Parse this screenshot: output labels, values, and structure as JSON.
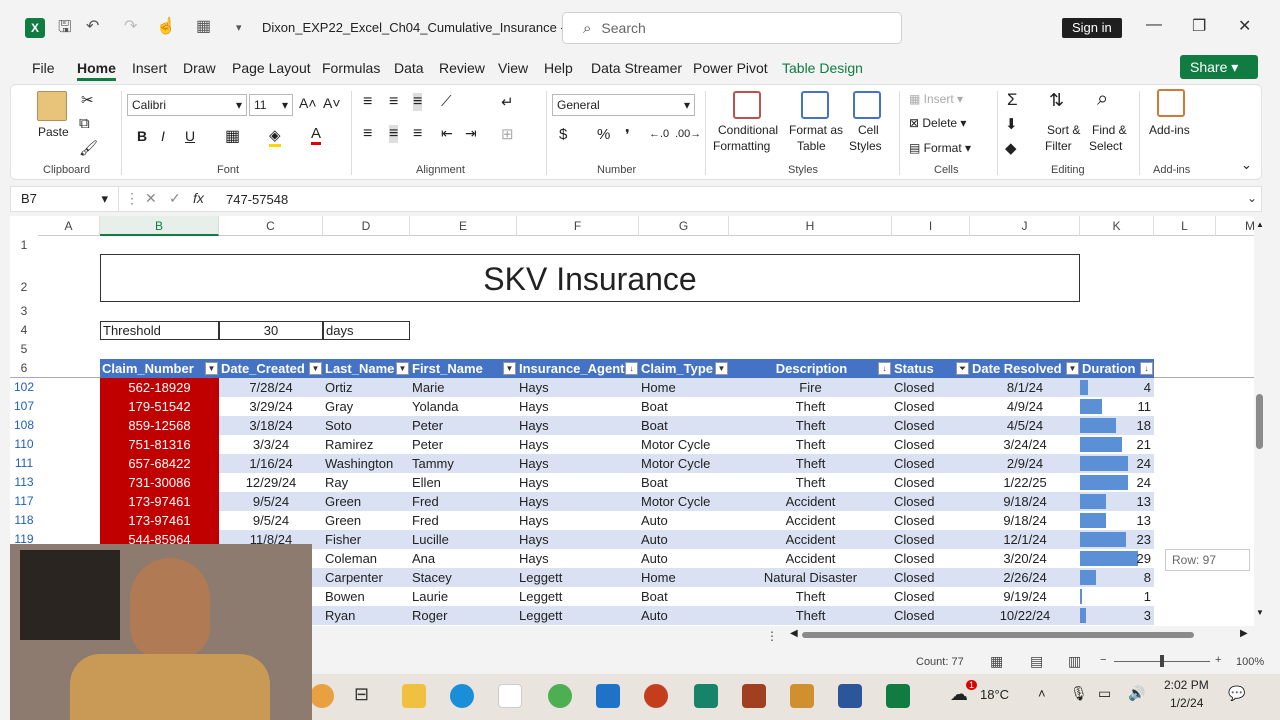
{
  "title_bar": {
    "doc_title": "Dixon_EXP22_Excel_Ch04_Cumulative_Insurance  -...",
    "search_placeholder": "Search",
    "sign_in": "Sign in",
    "app_letter": "X"
  },
  "menu": [
    "File",
    "Home",
    "Insert",
    "Draw",
    "Page Layout",
    "Formulas",
    "Data",
    "Review",
    "View",
    "Help",
    "Data Streamer",
    "Power Pivot",
    "Table Design"
  ],
  "share_label": "Share",
  "ribbon": {
    "clipboard": {
      "paste": "Paste",
      "label": "Clipboard"
    },
    "font": {
      "name": "Calibri",
      "size": "11",
      "label": "Font"
    },
    "alignment": {
      "label": "Alignment"
    },
    "number": {
      "format": "General",
      "label": "Number"
    },
    "styles": {
      "conditional": "Conditional",
      "formatting": "Formatting",
      "format_as": "Format as",
      "table": "Table",
      "cell": "Cell",
      "cell_styles": "Styles",
      "label": "Styles"
    },
    "cells": {
      "insert": "Insert",
      "delete": "Delete",
      "format": "Format",
      "label": "Cells"
    },
    "editing": {
      "sort": "Sort &",
      "filter": "Filter",
      "find": "Find &",
      "select": "Select",
      "label": "Editing"
    },
    "addins": {
      "addins": "Add-ins",
      "label": "Add-ins"
    }
  },
  "formula_bar": {
    "name_box": "B7",
    "fx": "fx",
    "value": "747-57548"
  },
  "columns": [
    "A",
    "B",
    "C",
    "D",
    "E",
    "F",
    "G",
    "H",
    "I",
    "J",
    "K",
    "L",
    "M"
  ],
  "sheet_title": "SKV Insurance",
  "threshold": {
    "label": "Threshold",
    "value": "30",
    "unit": "days"
  },
  "headers": [
    "Claim_Number",
    "Date_Created",
    "Last_Name",
    "First_Name",
    "Insurance_Agent",
    "Claim_Type",
    "Description",
    "Status",
    "Date Resolved",
    "Duration"
  ],
  "rows": [
    {
      "row": "102",
      "claim": "562-18929",
      "date": "7/28/24",
      "last": "Ortiz",
      "first": "Marie",
      "agent": "Hays",
      "type": "Home",
      "desc": "Fire",
      "status": "Closed",
      "resolved": "8/1/24",
      "duration": "4",
      "dur_value": 4
    },
    {
      "row": "107",
      "claim": "179-51542",
      "date": "3/29/24",
      "last": "Gray",
      "first": "Yolanda",
      "agent": "Hays",
      "type": "Boat",
      "desc": "Theft",
      "status": "Closed",
      "resolved": "4/9/24",
      "duration": "11",
      "dur_value": 11
    },
    {
      "row": "108",
      "claim": "859-12568",
      "date": "3/18/24",
      "last": "Soto",
      "first": "Peter",
      "agent": "Hays",
      "type": "Boat",
      "desc": "Theft",
      "status": "Closed",
      "resolved": "4/5/24",
      "duration": "18",
      "dur_value": 18
    },
    {
      "row": "110",
      "claim": "751-81316",
      "date": "3/3/24",
      "last": "Ramirez",
      "first": "Peter",
      "agent": "Hays",
      "type": "Motor Cycle",
      "desc": "Theft",
      "status": "Closed",
      "resolved": "3/24/24",
      "duration": "21",
      "dur_value": 21
    },
    {
      "row": "111",
      "claim": "657-68422",
      "date": "1/16/24",
      "last": "Washington",
      "first": "Tammy",
      "agent": "Hays",
      "type": "Motor Cycle",
      "desc": "Theft",
      "status": "Closed",
      "resolved": "2/9/24",
      "duration": "24",
      "dur_value": 24
    },
    {
      "row": "113",
      "claim": "731-30086",
      "date": "12/29/24",
      "last": "Ray",
      "first": "Ellen",
      "agent": "Hays",
      "type": "Boat",
      "desc": "Theft",
      "status": "Closed",
      "resolved": "1/22/25",
      "duration": "24",
      "dur_value": 24
    },
    {
      "row": "117",
      "claim": "173-97461",
      "date": "9/5/24",
      "last": "Green",
      "first": "Fred",
      "agent": "Hays",
      "type": "Motor Cycle",
      "desc": "Accident",
      "status": "Closed",
      "resolved": "9/18/24",
      "duration": "13",
      "dur_value": 13
    },
    {
      "row": "118",
      "claim": "173-97461",
      "date": "9/5/24",
      "last": "Green",
      "first": "Fred",
      "agent": "Hays",
      "type": "Auto",
      "desc": "Accident",
      "status": "Closed",
      "resolved": "9/18/24",
      "duration": "13",
      "dur_value": 13
    },
    {
      "row": "119",
      "claim": "544-85964",
      "date": "11/8/24",
      "last": "Fisher",
      "first": "Lucille",
      "agent": "Hays",
      "type": "Auto",
      "desc": "Accident",
      "status": "Closed",
      "resolved": "12/1/24",
      "duration": "23",
      "dur_value": 23
    },
    {
      "row": "",
      "claim": "",
      "date": "",
      "last": "Coleman",
      "first": "Ana",
      "agent": "Hays",
      "type": "Auto",
      "desc": "Accident",
      "status": "Closed",
      "resolved": "3/20/24",
      "duration": "29",
      "dur_value": 29
    },
    {
      "row": "",
      "claim": "",
      "date": "",
      "last": "Carpenter",
      "first": "Stacey",
      "agent": "Leggett",
      "type": "Home",
      "desc": "Natural Disaster",
      "status": "Closed",
      "resolved": "2/26/24",
      "duration": "8",
      "dur_value": 8
    },
    {
      "row": "",
      "claim": "",
      "date": "",
      "last": "Bowen",
      "first": "Laurie",
      "agent": "Leggett",
      "type": "Boat",
      "desc": "Theft",
      "status": "Closed",
      "resolved": "9/19/24",
      "duration": "1",
      "dur_value": 1
    },
    {
      "row": "",
      "claim": "",
      "date": "",
      "last": "Ryan",
      "first": "Roger",
      "agent": "Leggett",
      "type": "Auto",
      "desc": "Theft",
      "status": "Closed",
      "resolved": "10/22/24",
      "duration": "3",
      "dur_value": 3
    }
  ],
  "tooltip": "Row: 97",
  "status": {
    "count": "Count: 77",
    "zoom": "100%"
  },
  "taskbar": {
    "temp": "18°C",
    "time": "2:02 PM",
    "date": "1/2/24",
    "badge": "1"
  },
  "colors": {
    "accent": "#107c41",
    "header": "#4472c4",
    "red": "#c00000",
    "band": "#d9e1f2",
    "bar": "#5b8fd6"
  }
}
